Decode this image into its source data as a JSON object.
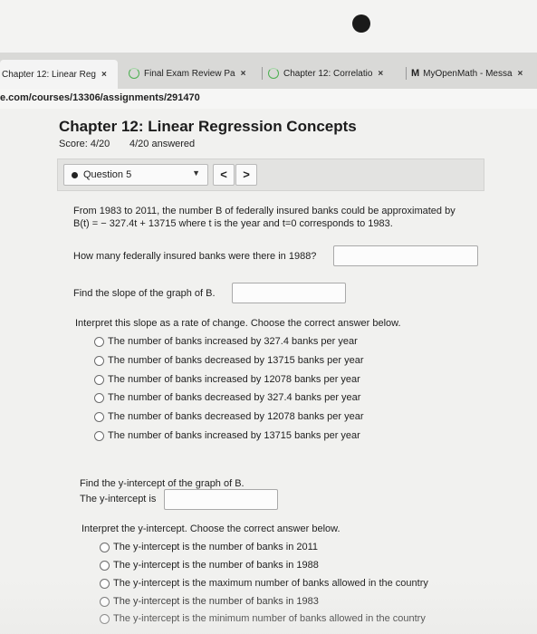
{
  "tabs": [
    {
      "label": "Chapter 12: Linear Reg",
      "close": "×"
    },
    {
      "label": "Final Exam Review Pa",
      "close": "×"
    },
    {
      "label": "Chapter 12: Correlatio",
      "close": "×"
    },
    {
      "label": "MyOpenMath - Messa",
      "close": "×",
      "logo": "M"
    }
  ],
  "url": "e.com/courses/13306/assignments/291470",
  "page": {
    "title": "Chapter 12: Linear Regression Concepts",
    "score": "Score: 4/20",
    "answered": "4/20 answered"
  },
  "question_nav": {
    "selected": "Question 5",
    "caret": "▼",
    "prev": "<",
    "next": ">"
  },
  "question": {
    "intro_line1": "From 1983 to 2011, the number B of federally insured banks could be approximated by",
    "intro_line2": "B(t) = − 327.4t + 13715 where t is the year and t=0 corresponds to 1983.",
    "part1": "How many federally insured banks were there in 1988?",
    "part2": "Find the slope of the graph of B.",
    "part3": "Interpret this slope as a rate of change. Choose the correct answer below.",
    "slope_options": [
      "The number of banks increased by 327.4 banks per year",
      "The number of banks decreased by 13715 banks per year",
      "The number of banks increased by 12078 banks per year",
      "The number of banks decreased by 327.4 banks per year",
      "The number of banks decreased by 12078 banks per year",
      "The number of banks increased by 13715 banks per year"
    ],
    "part4": "Find the y-intercept of the graph of B.",
    "part4b": "The y-intercept is",
    "part5": "Interpret the y-intercept. Choose the correct answer below.",
    "intercept_options": [
      "The y-intercept is the number of banks in 2011",
      "The y-intercept is the number of banks in 1988",
      "The y-intercept is the maximum number of banks allowed in the country",
      "The y-intercept is the number of banks in 1983",
      "The y-intercept is the minimum number of banks allowed in the country"
    ]
  }
}
